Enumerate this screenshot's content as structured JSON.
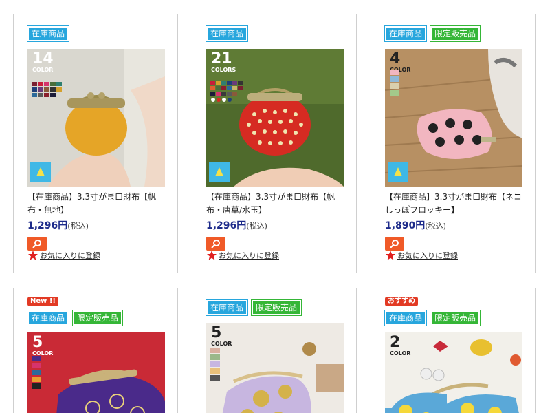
{
  "products": [
    {
      "tags": [
        "在庫商品"
      ],
      "name": "【在庫商品】3.3寸がま口財布【帆布・無地】",
      "price": "1,296円",
      "tax": "(税込)",
      "fav": "お気に入りに登録",
      "color_count": "14",
      "color_label": "COLOR"
    },
    {
      "tags": [
        "在庫商品"
      ],
      "name": "【在庫商品】3.3寸がま口財布【帆布・唐草/水玉】",
      "price": "1,296円",
      "tax": "(税込)",
      "fav": "お気に入りに登録",
      "color_count": "21",
      "color_label": "COLORS"
    },
    {
      "tags": [
        "在庫商品",
        "限定販売品"
      ],
      "name": "【在庫商品】3.3寸がま口財布【ネコしっぽフロッキー】",
      "price": "1,890円",
      "tax": "(税込)",
      "fav": "お気に入りに登録",
      "color_count": "4",
      "color_label": "COLOR"
    },
    {
      "top_badge": "New !!",
      "tags": [
        "在庫商品",
        "限定販売品"
      ],
      "color_count": "5",
      "color_label": "COLOR"
    },
    {
      "tags": [
        "在庫商品",
        "限定販売品"
      ],
      "color_count": "5",
      "color_label": "COLOR"
    },
    {
      "top_badge": "おすすめ",
      "tags": [
        "在庫商品",
        "限定販売品"
      ],
      "color_count": "2",
      "color_label": "COLOR"
    }
  ],
  "colors": {
    "stock_tag": "#27a6dd",
    "limited_tag": "#35b637",
    "price": "#1c2a8a",
    "zoom_button": "#f05a28",
    "new_badge": "#e23a24"
  }
}
